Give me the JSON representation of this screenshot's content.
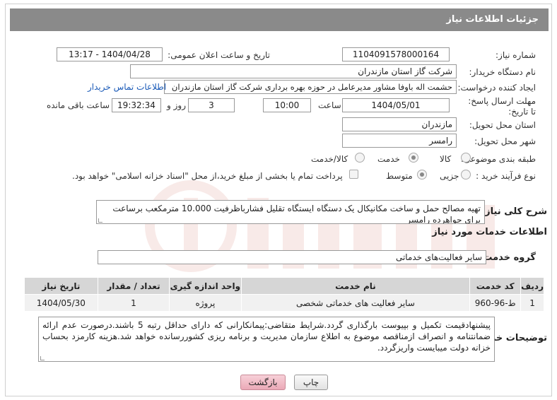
{
  "header": {
    "title": "جزئیات اطلاعات نیاز"
  },
  "fields": {
    "need_number_label": "شماره نیاز:",
    "need_number": "1104091578000164",
    "announce_label": "تاریخ و ساعت اعلان عمومی:",
    "announce_value": "1404/04/28 - 13:17",
    "buyer_label": "نام دستگاه خریدار:",
    "buyer_value": "شرکت گاز استان مازندران",
    "creator_label": "ایجاد کننده درخواست:",
    "creator_value": "حشمت اله باوفا مشاور مدیرعامل در حوزه بهره برداری  شرکت گاز استان مازندران",
    "contact_link": "اطلاعات تماس خریدار",
    "deadline_label": "مهلت ارسال پاسخ: تا تاریخ:",
    "deadline_date": "1404/05/01",
    "time_label": "ساعت",
    "deadline_time": "10:00",
    "days_value": "3",
    "days_label": "روز و",
    "remaining_time": "19:32:34",
    "remaining_label": "ساعت باقی مانده",
    "province_label": "استان محل تحویل:",
    "province_value": "مازندران",
    "city_label": "شهر محل تحویل:",
    "city_value": "رامسر",
    "category_label": "طبقه بندی موضوعی:",
    "category_options": [
      "کالا",
      "خدمت",
      "کالا/خدمت"
    ],
    "process_label": "نوع فرآیند خرید :",
    "process_options": [
      "جزیی",
      "متوسط"
    ],
    "payment_note": "پرداخت تمام یا بخشی از مبلغ خرید،از محل \"اسناد خزانه اسلامی\" خواهد بود."
  },
  "description": {
    "label": "شرح کلی نیاز:",
    "text": "تهیه مصالح حمل و ساخت مکانیکال یک دستگاه ایستگاه تقلیل فشارباظرفیت 10.000 مترمکعب برساعت برای جواهرده رامسر"
  },
  "services": {
    "section_title": "اطلاعات خدمات مورد نیاز",
    "group_label": "گروه خدمت:",
    "group_value": "سایر فعالیت‌های خدماتی",
    "columns": [
      "ردیف",
      "کد خدمت",
      "نام خدمت",
      "واحد اندازه گیری",
      "تعداد / مقدار",
      "تاریخ نیاز"
    ],
    "rows": [
      [
        "1",
        "ط-96-960",
        "سایر فعالیت های خدماتی شخصی",
        "پروژه",
        "1",
        "1404/05/30"
      ]
    ]
  },
  "buyer_notes": {
    "label": "توضیحات خریدار:",
    "text": "پیشنهادقیمت تکمیل و بپیوست بارگذاری گردد.شرایط متقاضی:پیمانکارانی که دارای حداقل رتبه 5 باشند.درصورت عدم ارائه ضمانتنامه و انصراف ازمناقصه موضوع به اطلاع سازمان مدیریت و برنامه ریزی کشوررسانده خواهد شد.هزینه کارمزد بحساب خزانه دولت میبایست واریزگردد."
  },
  "buttons": {
    "print": "چاپ",
    "back": "بازگشت"
  },
  "colors": {
    "header_bg": "#8a8a8a",
    "link": "#1a5ab8",
    "back_button": "#eba9b7"
  }
}
